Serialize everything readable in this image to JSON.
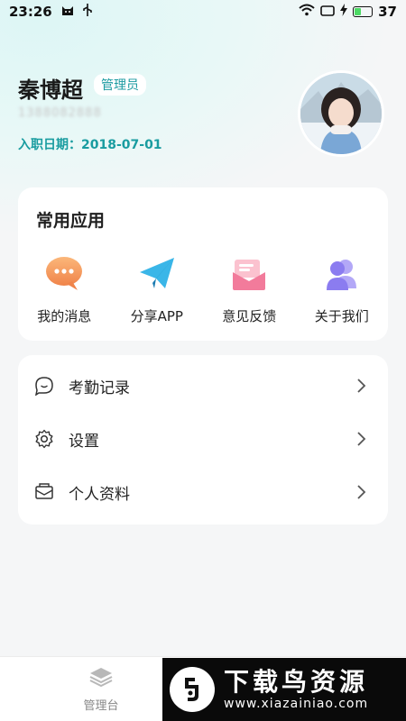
{
  "status_bar": {
    "time": "23:26",
    "battery": "37",
    "battery_level": 0.37
  },
  "profile": {
    "name": "秦博超",
    "role": "管理员",
    "phone": "1388082888",
    "join_date": "入职日期：2018-07-01"
  },
  "apps": {
    "title": "常用应用",
    "items": [
      {
        "label": "我的消息",
        "icon": "chat-bubble-icon",
        "color": "#f59a5a"
      },
      {
        "label": "分享APP",
        "icon": "paper-plane-icon",
        "color": "#3ab6e8"
      },
      {
        "label": "意见反馈",
        "icon": "envelope-icon",
        "color": "#f27b9b"
      },
      {
        "label": "关于我们",
        "icon": "people-icon",
        "color": "#8b7cf0"
      }
    ]
  },
  "menu": {
    "items": [
      {
        "label": "考勤记录",
        "icon": "chat-smile-icon"
      },
      {
        "label": "设置",
        "icon": "gear-icon"
      },
      {
        "label": "个人资料",
        "icon": "mail-icon"
      }
    ]
  },
  "tabbar": {
    "items": [
      {
        "label": "管理台",
        "icon": "layers-icon"
      }
    ]
  },
  "watermark": {
    "title": "下载鸟资源",
    "url": "www.xiazainiao.com"
  },
  "colors": {
    "accent": "#199ca0",
    "background": "#f5f6f7"
  }
}
